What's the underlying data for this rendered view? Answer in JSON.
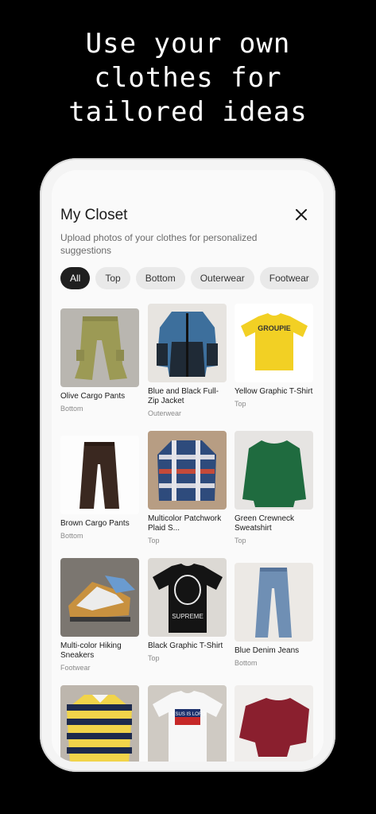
{
  "headline": {
    "line1": "Use your own",
    "line2": "clothes for",
    "line3": "tailored ideas"
  },
  "closet": {
    "title": "My Closet",
    "subtitle": "Upload photos of your clothes for personalized suggestions",
    "filters": [
      "All",
      "Top",
      "Bottom",
      "Outerwear",
      "Footwear"
    ],
    "active_filter": "All",
    "items": [
      {
        "name": "Olive Cargo Pants",
        "category": "Bottom"
      },
      {
        "name": "Blue and Black Full-Zip Jacket",
        "category": "Outerwear"
      },
      {
        "name": "Yellow Graphic T-Shirt",
        "category": "Top",
        "print": "GROUPIE"
      },
      {
        "name": "Brown Cargo Pants",
        "category": "Bottom"
      },
      {
        "name": "Multicolor Patchwork Plaid S...",
        "category": "Top"
      },
      {
        "name": "Green Crewneck Sweatshirt",
        "category": "Top"
      },
      {
        "name": "Multi-color Hiking Sneakers",
        "category": "Footwear"
      },
      {
        "name": "Black Graphic T-Shirt",
        "category": "Top",
        "print": "SUPREME"
      },
      {
        "name": "Blue Denim Jeans",
        "category": "Bottom"
      },
      {
        "name": "",
        "category": ""
      },
      {
        "name": "",
        "category": "",
        "print": "JESUS IS LORD"
      },
      {
        "name": "",
        "category": ""
      }
    ]
  }
}
